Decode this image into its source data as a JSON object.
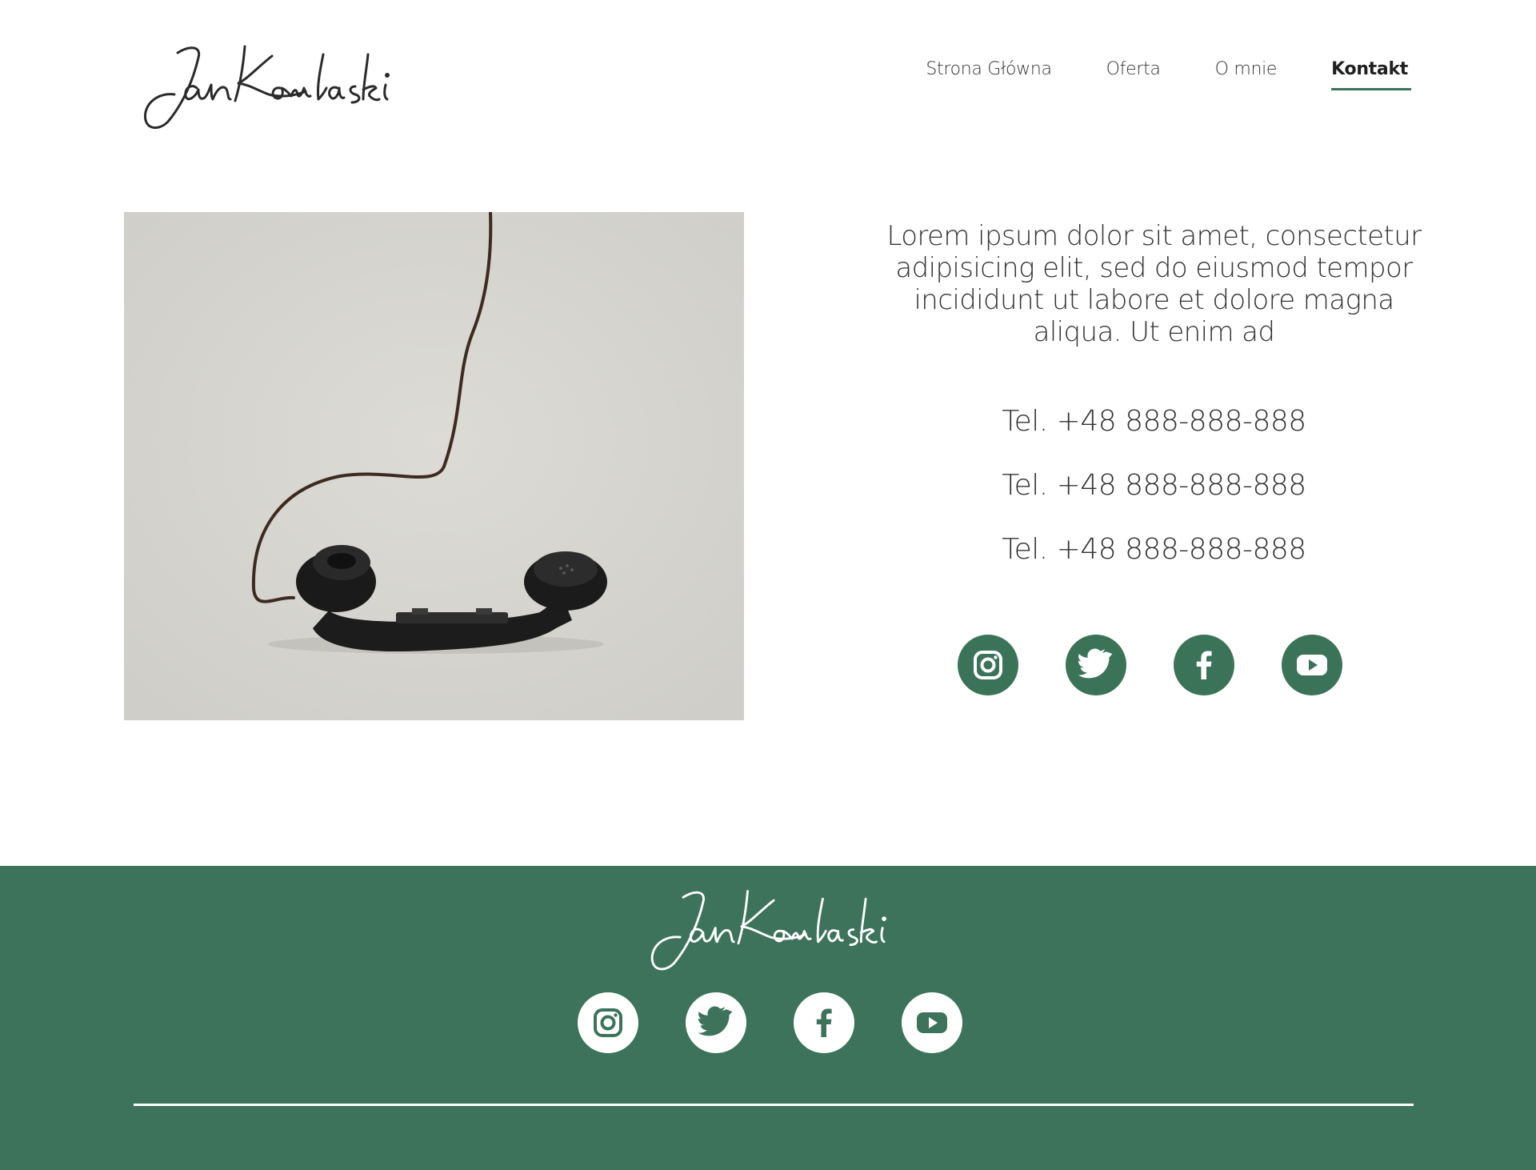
{
  "brand": {
    "logo_text": "JanKowlaski"
  },
  "nav": {
    "items": [
      {
        "label": "Strona Główna",
        "active": false
      },
      {
        "label": "Oferta",
        "active": false
      },
      {
        "label": "O mnie",
        "active": false
      },
      {
        "label": "Kontakt",
        "active": true
      }
    ]
  },
  "contact": {
    "intro": "Lorem ipsum dolor sit amet, consectetur adipisicing elit, sed do eiusmod tempor incididunt ut labore et dolore magna aliqua. Ut enim ad",
    "phones": [
      "Tel. +48 888-888-888",
      "Tel. +48 888-888-888",
      "Tel. +48 888-888-888"
    ]
  },
  "socials": [
    "instagram-icon",
    "twitter-icon",
    "facebook-icon",
    "youtube-icon"
  ],
  "colors": {
    "accent": "#3b7359",
    "footer_bg": "#3c735a",
    "text": "#333333"
  }
}
